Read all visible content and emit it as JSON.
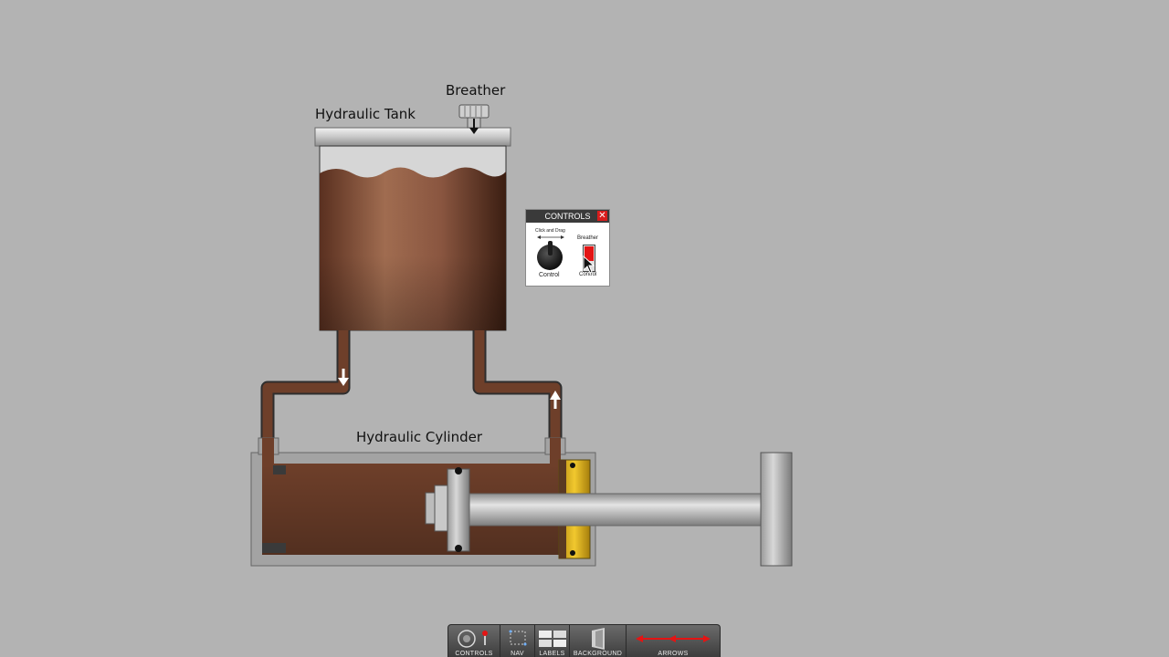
{
  "labels": {
    "hydraulic_tank": "Hydraulic Tank",
    "breather": "Breather",
    "hydraulic_cylinder": "Hydraulic Cylinder"
  },
  "controls_panel": {
    "title": "CONTROLS",
    "close_symbol": "✕",
    "hint": "Click and Drag",
    "knob_label": "Control",
    "switch_title": "Breather",
    "switch_label": "Control"
  },
  "toolbar": {
    "items": [
      {
        "label": "CONTROLS",
        "icon": "controls-icon"
      },
      {
        "label": "NAV",
        "icon": "nav-icon"
      },
      {
        "label": "LABELS",
        "icon": "labels-icon"
      },
      {
        "label": "BACKGROUND",
        "icon": "background-icon"
      },
      {
        "label": "ARROWS",
        "icon": "arrows-icon"
      }
    ]
  },
  "colors": {
    "background": "#b3b3b3",
    "oil": "#6e3f2a",
    "steel": "#a8a8a8",
    "seal": "#e0b41c",
    "close": "#d81c1c",
    "arrow": "#e31414"
  }
}
